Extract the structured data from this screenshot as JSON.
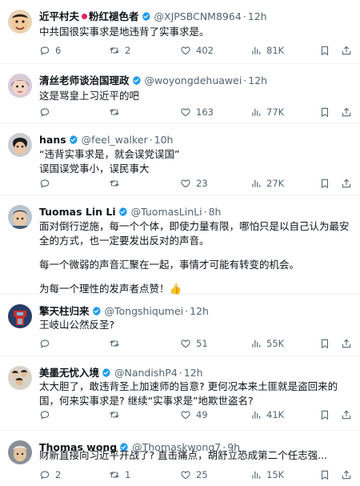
{
  "tweets": [
    {
      "name": "近平村夫",
      "name_suffix": "粉红褪色者",
      "handle": "@XJPSBCNM8964",
      "time": "12h",
      "lines": [
        "中共国很实事求是地违背了实事求是。"
      ],
      "replies": "6",
      "reposts": "2",
      "likes": "402",
      "views": "81K"
    },
    {
      "name": "清丝老师谈治国理政",
      "handle": "@woyongdehuawei",
      "time": "12h",
      "lines": [
        "这是骂皇上习近平的吧"
      ],
      "replies": "",
      "reposts": "",
      "likes": "163",
      "views": "77K"
    },
    {
      "name": "hans",
      "handle": "@feel_walker",
      "time": "10h",
      "lines": [
        "“违背实事求是，就会误党误国”",
        "误国误党事小，误民事大"
      ],
      "replies": "",
      "reposts": "",
      "likes": "23",
      "views": "27K"
    },
    {
      "name": "Tuomas Lin Li",
      "handle": "@TuomasLinLi",
      "time": "8h",
      "lines": [
        "面对倒行逆施，每一个个体，即使力量有限，哪怕只是以自己认为最安全的方式，也一定要发出反对的声音。",
        "每一个微弱的声音汇聚在一起，事情才可能有转变的机会。",
        "为每一个理性的发声者点赞！👍"
      ],
      "replies": "",
      "reposts": "",
      "likes": "",
      "views": ""
    },
    {
      "name": "擎天柱归来",
      "handle": "@Tongshiqumei",
      "time": "12h",
      "lines": [
        "王岐山公然反圣?"
      ],
      "replies": "",
      "reposts": "",
      "likes": "51",
      "views": "55K"
    },
    {
      "name": "美墨无忧入境",
      "handle": "@NandishP4",
      "time": "12h",
      "lines": [
        "太大胆了，敢违背圣上加速师的旨意? 更何况本来土匪就是盗回来的国，何来实事求是? 继续“实事求是”地欺世盗名?"
      ],
      "replies": "",
      "reposts": "",
      "likes": "49",
      "views": "41K"
    },
    {
      "name": "Thomas wong",
      "handle": "@Thomaskwong7",
      "time": "9h",
      "lines": [
        "财新直接向习近平开战了? 直击痛点，胡舒立恐成第二个任志强..."
      ],
      "replies": "2",
      "reposts": "1",
      "likes": "25",
      "views": "15K"
    }
  ],
  "colors": {
    "text": "#0f1419",
    "meta": "#536471",
    "verified": "#1d9bf0",
    "divider": "#eff3f4"
  },
  "icons": {
    "reply": "reply-icon",
    "repost": "repost-icon",
    "like": "heart-icon",
    "views": "views-icon",
    "bookmark": "bookmark-icon",
    "share": "share-icon",
    "verified": "verified-badge-icon"
  }
}
